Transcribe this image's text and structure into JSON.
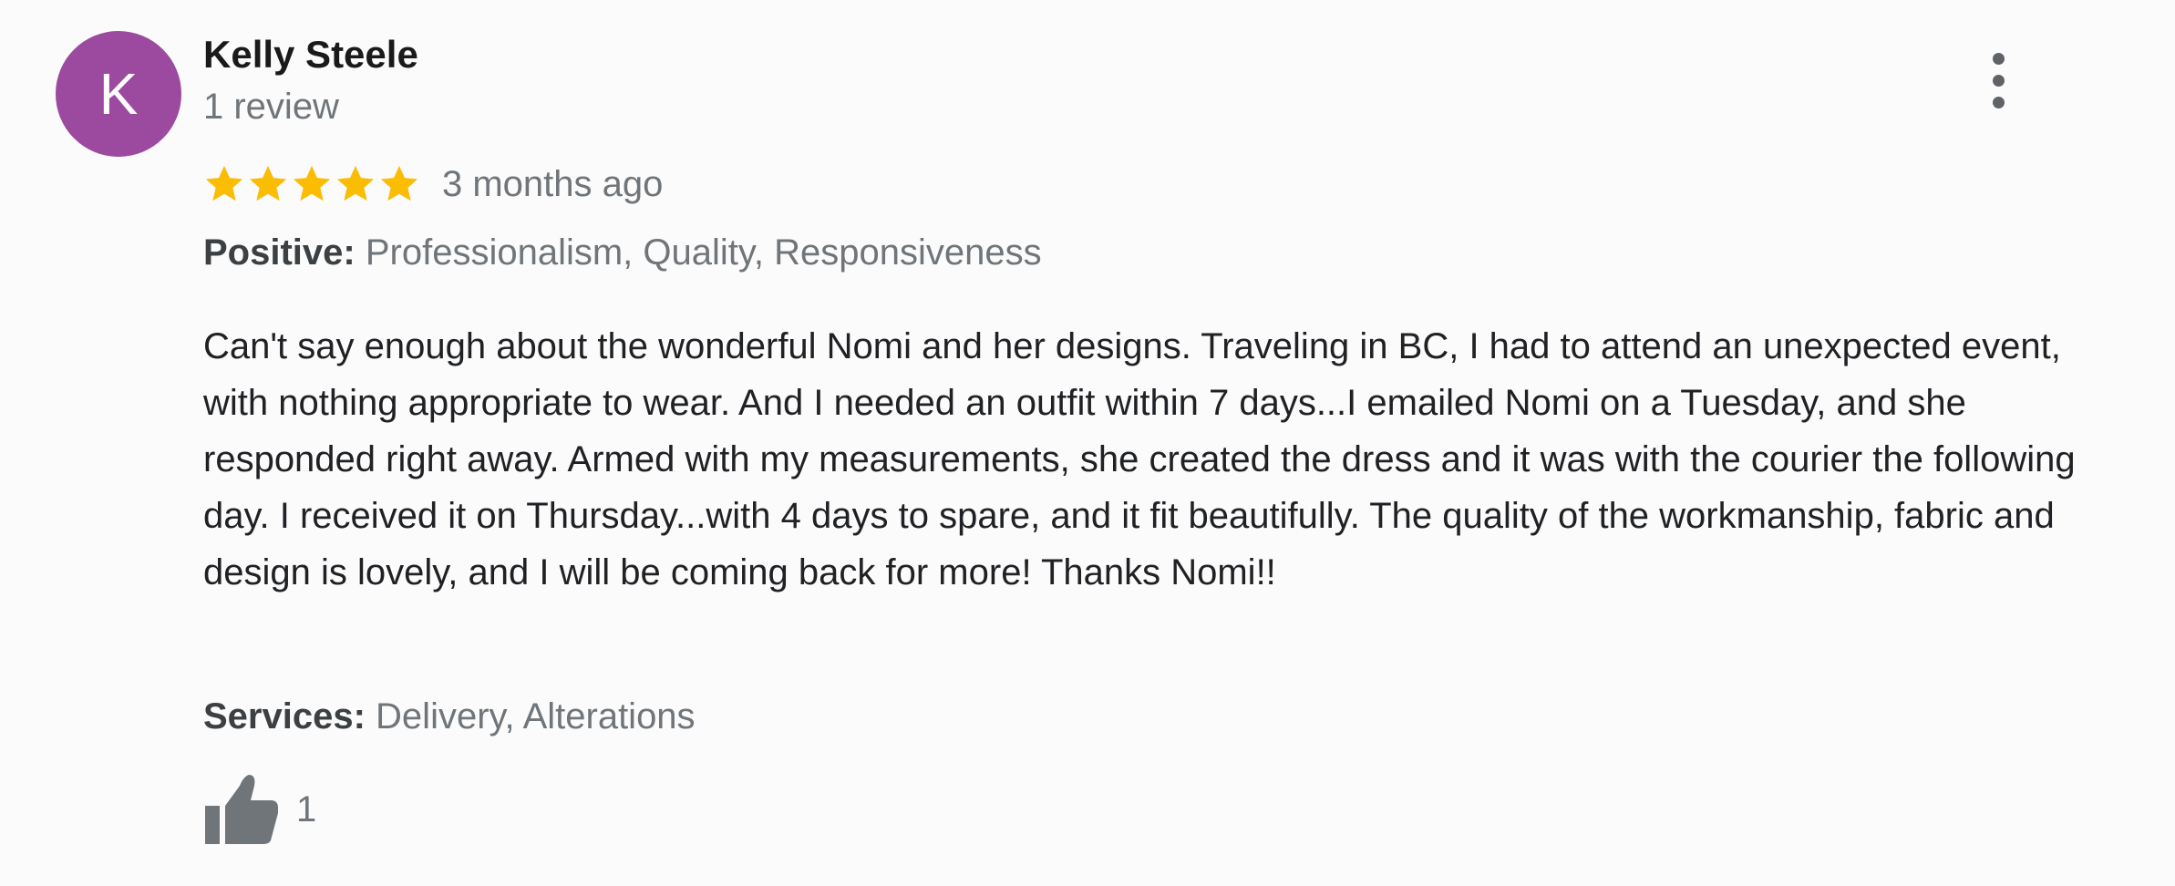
{
  "reviewer": {
    "avatar_letter": "K",
    "avatar_color": "#9c4a9f",
    "name": "Kelly Steele",
    "review_count": "1 review"
  },
  "rating": {
    "stars": 5,
    "max_stars": 5,
    "star_color": "#fbbc04",
    "date": "3 months ago"
  },
  "positive": {
    "label": "Positive:",
    "value": "Professionalism, Quality, Responsiveness"
  },
  "review_text": "Can't say enough about the wonderful Nomi and her designs. Traveling in BC, I had to attend an unexpected event, with nothing appropriate to wear. And I needed an outfit within 7 days...I emailed Nomi on a Tuesday, and she responded right away. Armed with my measurements, she created the dress and it was with the courier the following day. I received it on Thursday...with 4 days to spare, and it fit beautifully. The quality of the workmanship, fabric and design is lovely, and I will be coming back for more! Thanks Nomi!!",
  "services": {
    "label": "Services:",
    "value": "Delivery, Alterations"
  },
  "likes": {
    "icon": "thumbs-up-icon",
    "count": "1"
  },
  "menu": {
    "icon": "more-vert-icon"
  }
}
